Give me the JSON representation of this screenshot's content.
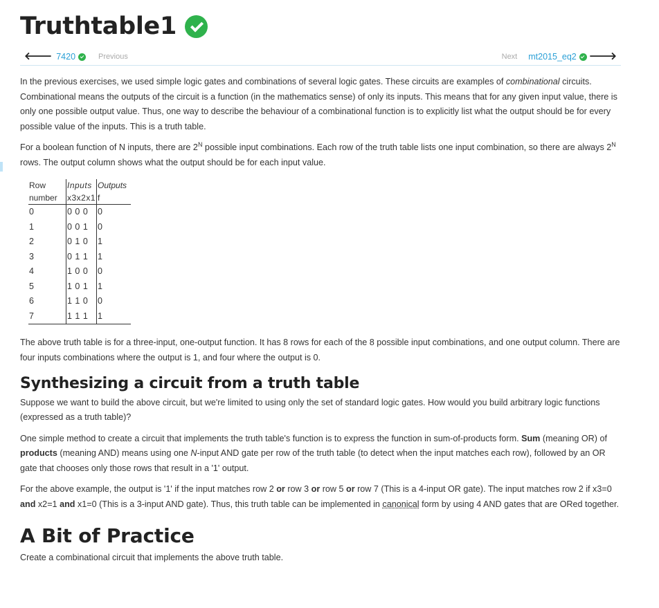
{
  "page": {
    "title": "Truthtable1",
    "title_status_icon": "check-circle-icon"
  },
  "nav": {
    "prev_link": "7420",
    "prev_label": "Previous",
    "next_label": "Next",
    "next_link": "mt2015_eq2"
  },
  "intro": {
    "p1_a": "In the previous exercises, we used simple logic gates and combinations of several logic gates. These circuits are examples of ",
    "p1_em": "combinational",
    "p1_b": " circuits. Combinational means the outputs of the circuit is a function (in the mathematics sense) of only its inputs. This means that for any given input value, there is only one possible output value. Thus, one way to describe the behaviour of a combinational function is to explicitly list what the output should be for every possible value of the inputs. This is a truth table.",
    "p2_a": "For a boolean function of N inputs, there are 2",
    "p2_sup1": "N",
    "p2_b": " possible input combinations. Each row of the truth table lists one input combination, so there are always 2",
    "p2_sup2": "N",
    "p2_c": " rows. The output column shows what the output should be for each input value."
  },
  "truth_table": {
    "header1": [
      "Row",
      "Inputs",
      "Outputs"
    ],
    "header2": [
      "number",
      "x3x2x1",
      "f"
    ],
    "rows": [
      {
        "row": "0",
        "inputs": "0 0 0",
        "f": "0"
      },
      {
        "row": "1",
        "inputs": "0 0 1",
        "f": "0"
      },
      {
        "row": "2",
        "inputs": "0 1 0",
        "f": "1"
      },
      {
        "row": "3",
        "inputs": "0 1 1",
        "f": "1"
      },
      {
        "row": "4",
        "inputs": "1 0 0",
        "f": "0"
      },
      {
        "row": "5",
        "inputs": "1 0 1",
        "f": "1"
      },
      {
        "row": "6",
        "inputs": "1 1 0",
        "f": "0"
      },
      {
        "row": "7",
        "inputs": "1 1 1",
        "f": "1"
      }
    ]
  },
  "after_table": "The above truth table is for a three-input, one-output function. It has 8 rows for each of the 8 possible input combinations, and one output column. There are four inputs combinations where the output is 1, and four where the output is 0.",
  "section2": {
    "heading": "Synthesizing a circuit from a truth table",
    "p1": "Suppose we want to build the above circuit, but we're limited to using only the set of standard logic gates. How would you build arbitrary logic functions (expressed as a truth table)?",
    "p2_a": "One simple method to create a circuit that implements the truth table's function is to express the function in sum-of-products form. ",
    "p2_b_strong": "Sum",
    "p2_c": " (meaning OR) of ",
    "p2_d_strong": "products",
    "p2_e": " (meaning AND) means using one ",
    "p2_f_em": "N",
    "p2_g": "-input AND gate per row of the truth table (to detect when the input matches each row), followed by an OR gate that chooses only those rows that result in a '1' output.",
    "p3_a": "For the above example, the output is '1' if the input matches row 2 ",
    "p3_or1": "or",
    "p3_b": " row 3 ",
    "p3_or2": "or",
    "p3_c": " row 5 ",
    "p3_or3": "or",
    "p3_d": " row 7 (This is a 4-input OR gate). The input matches row 2 if x3=0 ",
    "p3_and1": "and",
    "p3_e": " x2=1 ",
    "p3_and2": "and",
    "p3_f": " x1=0 (This is a 3-input AND gate). Thus, this truth table can be implemented in ",
    "p3_canonical": "canonical",
    "p3_g": " form by using 4 AND gates that are ORed together."
  },
  "section3": {
    "heading": "A Bit of Practice",
    "p1": "Create a combinational circuit that implements the above truth table."
  }
}
